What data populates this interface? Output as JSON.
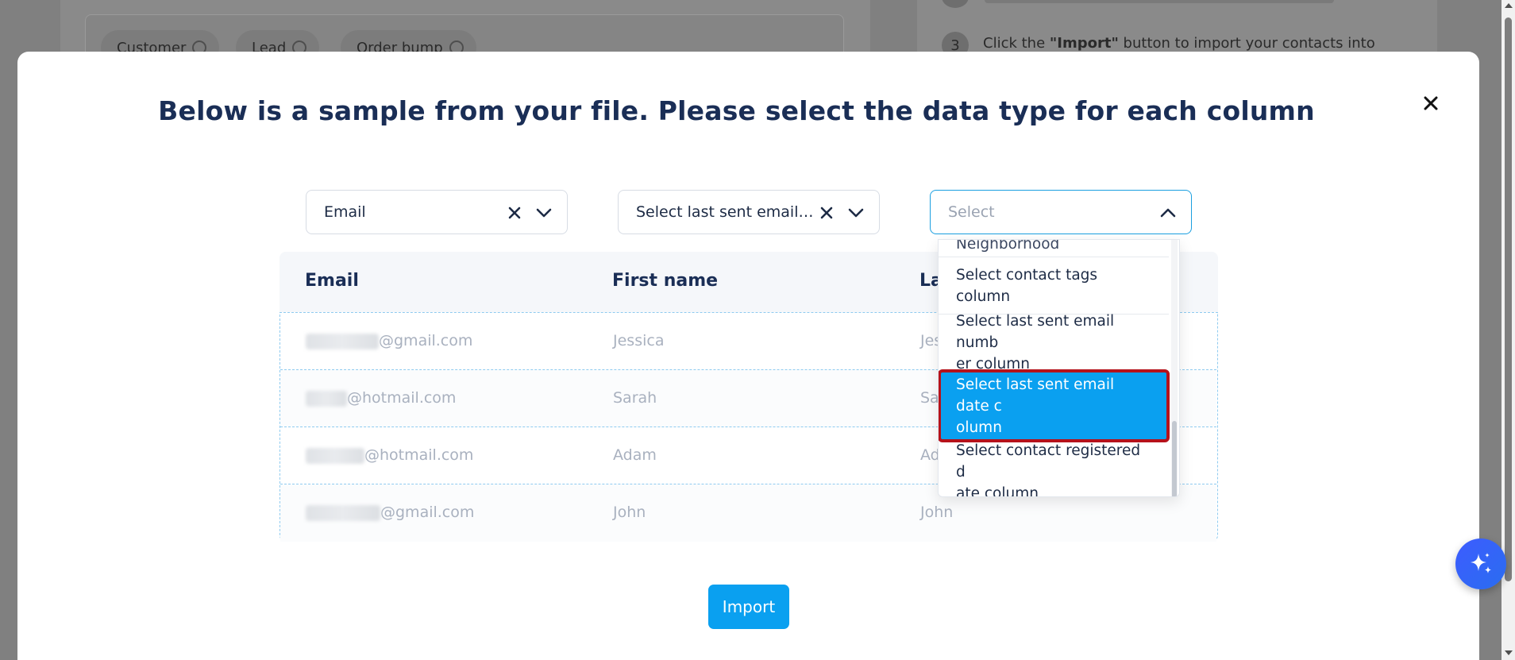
{
  "background": {
    "tags": [
      "Customer",
      "Lead",
      "Order bump"
    ],
    "step": {
      "number": "3",
      "text_pre": "Click the ",
      "text_bold": "\"Import\"",
      "text_post": " button to import your contacts into"
    }
  },
  "modal": {
    "title": "Below is a sample from your file. Please select the data type for each column",
    "selects": [
      {
        "value": "Email"
      },
      {
        "value": "Select last sent email n…"
      },
      {
        "placeholder": "Select"
      }
    ],
    "table": {
      "headers": [
        "Email",
        "First name",
        "La"
      ],
      "rows": [
        {
          "email_domain": "@gmail.com",
          "first_name": "Jessica",
          "last_name": "Jes"
        },
        {
          "email_domain": "@hotmail.com",
          "first_name": "Sarah",
          "last_name": "Sa"
        },
        {
          "email_domain": "@hotmail.com",
          "first_name": "Adam",
          "last_name": "Ad"
        },
        {
          "email_domain": "@gmail.com",
          "first_name": "John",
          "last_name": "John"
        }
      ]
    },
    "dropdown": {
      "partial_item": "Neighborhood",
      "items": [
        {
          "line1": "Select contact tags column",
          "line2": ""
        },
        {
          "line1": "Select last sent email numb",
          "line2": "er column"
        },
        {
          "line1": "Select last sent email date c",
          "line2": "olumn"
        },
        {
          "line1": "Select contact registered d",
          "line2": "ate column"
        }
      ],
      "selected_index": 2
    },
    "import_label": "Import"
  },
  "colors": {
    "accent": "#0aa0f0",
    "title": "#1a2e56",
    "highlight_outline": "#b5121b"
  }
}
